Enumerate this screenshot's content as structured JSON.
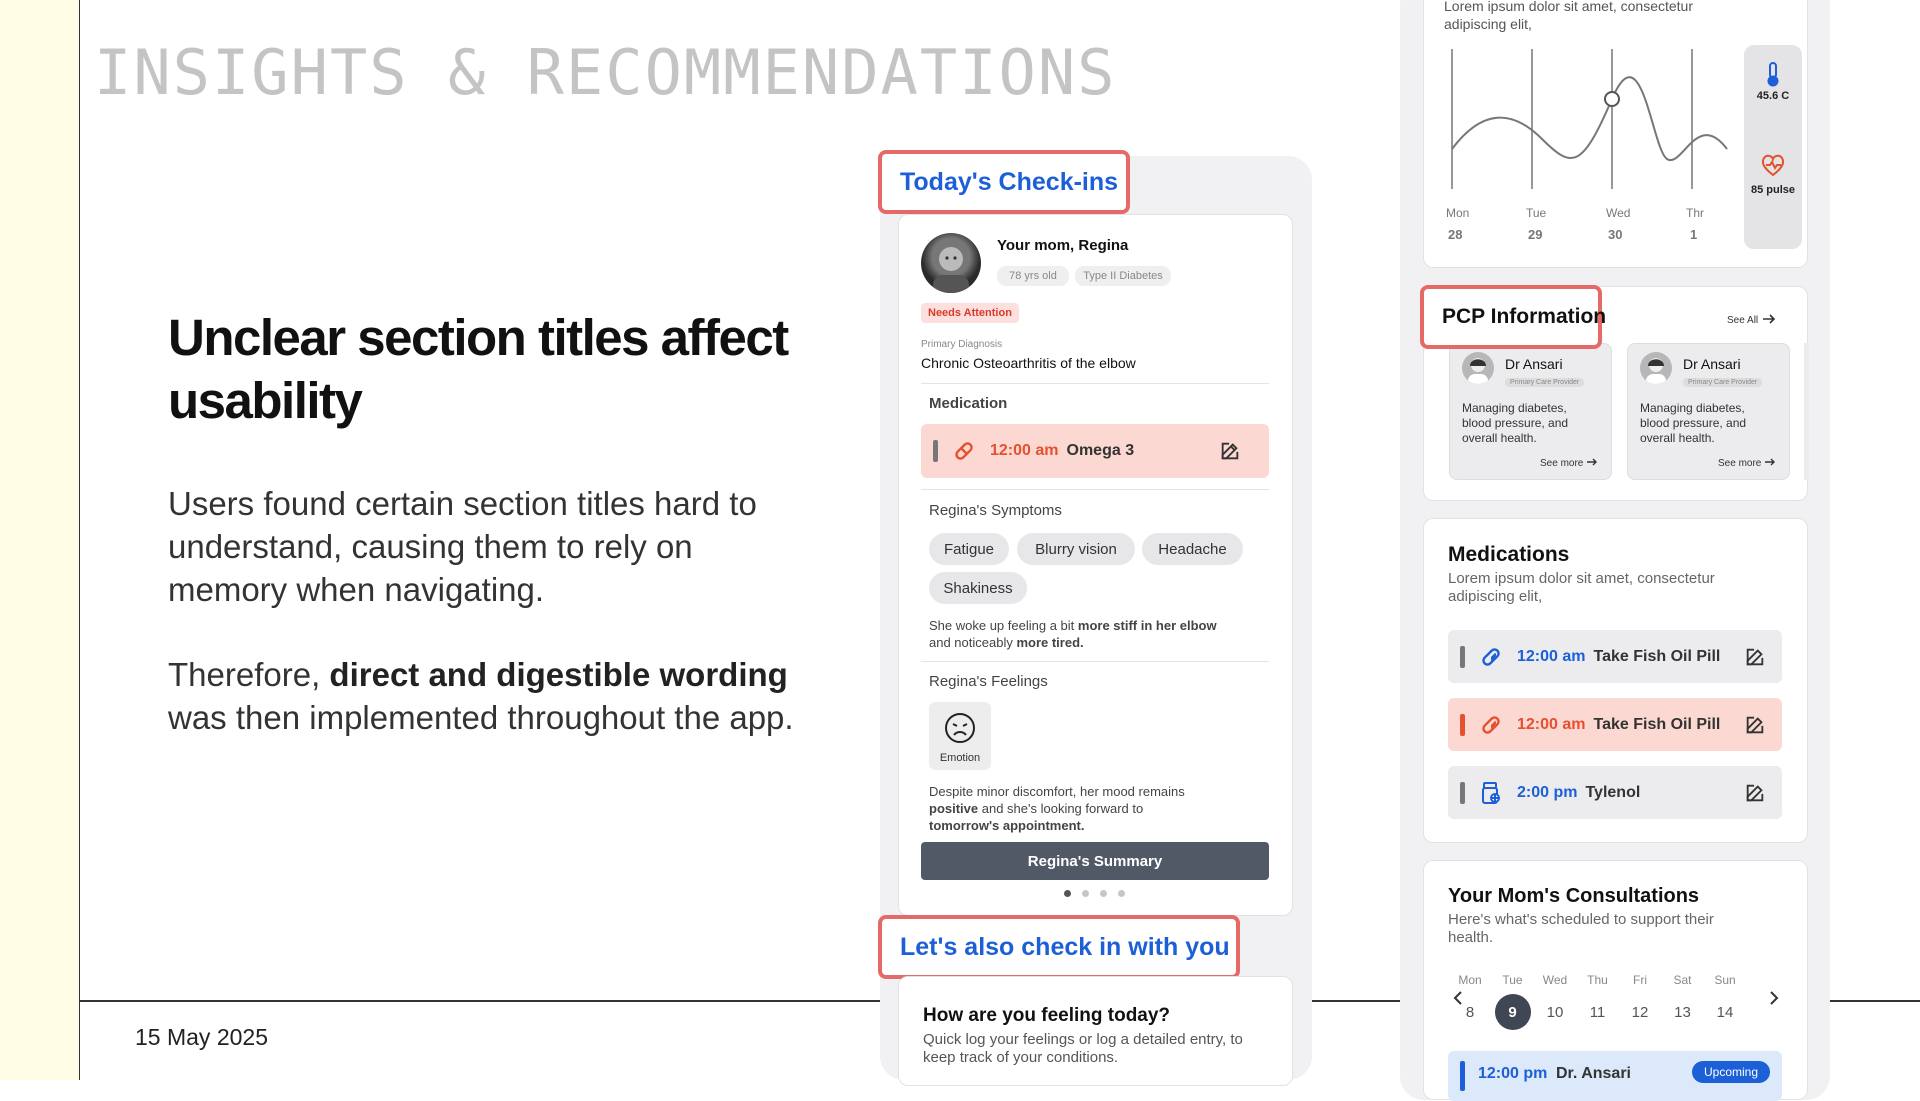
{
  "slide": {
    "eyebrow": "INSIGHTS & RECOMMENDATIONS",
    "headline": "Unclear section titles affect usability",
    "para1": "Users found certain section titles hard to understand, causing them to rely on memory when navigating.",
    "para2_pre": "Therefore, ",
    "para2_bold": "direct and digestible wording",
    "para2_post": " was then implemented throughout the app.",
    "date": "15 May 2025"
  },
  "checkins": {
    "callout": "Today's Check-ins",
    "patient_name": "Your mom, Regina",
    "age_tag": "78 yrs old",
    "condition_tag": "Type II Diabetes",
    "status_badge": "Needs Attention",
    "diag_label": "Primary Diagnosis",
    "diag_value": "Chronic Osteoarthritis of the elbow",
    "med_title": "Medication",
    "med_time": "12:00 am",
    "med_name": "Omega 3",
    "symptoms_title": "Regina's Symptoms",
    "symptoms": [
      "Fatigue",
      "Blurry vision",
      "Headache",
      "Shakiness"
    ],
    "symptom_note_1": "She woke up feeling a bit ",
    "symptom_note_bold1": "more stiff in her elbow",
    "symptom_note_2": "and noticeably ",
    "symptom_note_bold2": "more tired.",
    "feelings_title": "Regina's Feelings",
    "emotion_label": "Emotion",
    "feel_note_1": "Despite minor discomfort, her mood remains",
    "feel_note_bold1": "positive",
    "feel_note_2": " and she's looking forward to",
    "feel_note_bold2": "tomorrow's appointment.",
    "summary_button": "Regina's Summary",
    "also_callout": "Let's also check in with you",
    "how_title": "How are you feeling today?",
    "how_sub": "Quick log your feelings or log a detailed entry, to keep track of your conditions."
  },
  "vitals": {
    "lorem1": "Lorem ipsum dolor sit amet, consectetur",
    "lorem2": "adipiscing elit,",
    "days": [
      "Mon",
      "Tue",
      "Wed",
      "Thr"
    ],
    "dates": [
      "28",
      "29",
      "30",
      "1"
    ],
    "temp": "45.6 C",
    "pulse": "85 pulse"
  },
  "pcp": {
    "callout": "PCP Information",
    "see_all": "See All",
    "cards": [
      {
        "name": "Dr Ansari",
        "role": "Primary Care Provider",
        "desc": "Managing diabetes, blood pressure, and overall health.",
        "more": "See more"
      },
      {
        "name": "Dr Ansari",
        "role": "Primary Care Provider",
        "desc": "Managing diabetes, blood pressure, and overall health.",
        "more": "See more"
      }
    ]
  },
  "medications": {
    "title": "Medications",
    "sub": "Lorem ipsum dolor sit amet, consectetur adipiscing elit,",
    "items": [
      {
        "time": "12:00 am",
        "name": "Take Fish Oil Pill",
        "color": "#1c5fd6"
      },
      {
        "time": "12:00 am",
        "name": "Take Fish Oil Pill",
        "color": "#e5502f"
      },
      {
        "time": "2:00 pm",
        "name": "Tylenol",
        "color": "#1c5fd6"
      }
    ]
  },
  "consult": {
    "title": "Your Mom's Consultations",
    "sub": "Here's what's scheduled to support their health.",
    "weekdays": [
      "Mon",
      "Tue",
      "Wed",
      "Thu",
      "Fri",
      "Sat",
      "Sun"
    ],
    "dates": [
      "8",
      "9",
      "10",
      "11",
      "12",
      "13",
      "14"
    ],
    "selected_index": 1,
    "appt_time": "12:00 pm",
    "appt_doc": "Dr. Ansari",
    "appt_badge": "Upcoming"
  },
  "colors": {
    "accent_blue": "#1c5fd6",
    "alert_red": "#e5502f",
    "callout_border": "#e56a67",
    "badge_bg": "#fde0dd"
  }
}
